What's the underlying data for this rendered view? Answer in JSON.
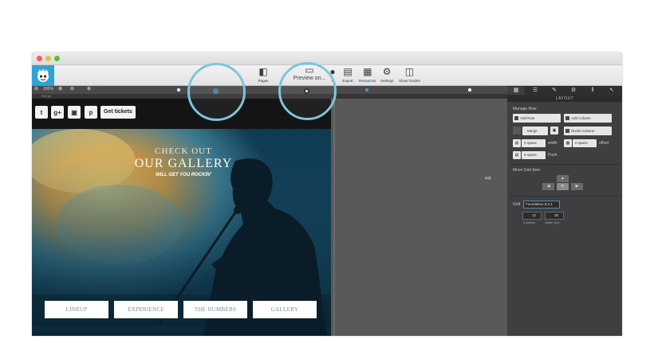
{
  "toolbar": {
    "pages_label": "Pages",
    "preview_label": "Preview on...",
    "partial_label": "P",
    "export_label": "Export",
    "resources_label": "Resources",
    "settings_label": "Settings",
    "guides_label": "Show Guides"
  },
  "subbar": {
    "zoom_value": "100%",
    "width_value": "910 px"
  },
  "site": {
    "get_tickets": "Get tickets",
    "hero_line1": "CHECK OUT",
    "hero_line2": "OUR GALLERY",
    "hero_line3": "WILL GET YOU ROCKIN'",
    "nav_buttons": [
      "LINEUP",
      "EXPERIENCE",
      "THE NUMBERS",
      "GALLERY"
    ]
  },
  "panel": {
    "section_title": "LAYOUT",
    "manage_row": "Manage Row",
    "add_row": "Add Row",
    "add_column": "Add Column",
    "merge": "Merge",
    "divide_column": "Divide Column",
    "spans_1": "0 spans",
    "width_label": "width",
    "spans_2": "0 spans",
    "offset_label": "offset",
    "spans_3": "0 spans",
    "push_label": "Push",
    "move_grid_item": "Move Grid Item",
    "grid_label": "Grid",
    "grid_value": "Foundation 6.2.1",
    "columns_value": "12",
    "gutter_value": "30",
    "columns_label": "Columns",
    "gutter_label": "Gutter (px)"
  },
  "colors": {
    "accent": "#2ea3d6",
    "callout": "#7cc6dc"
  }
}
